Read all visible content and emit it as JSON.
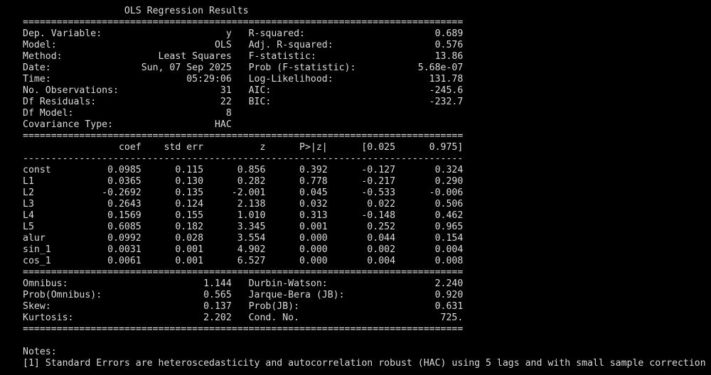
{
  "lines": [
    "                  OLS Regression Results                            ",
    "==============================================================================",
    "Dep. Variable:                      y   R-squared:                       0.689",
    "Model:                            OLS   Adj. R-squared:                  0.576",
    "Method:                 Least Squares   F-statistic:                     13.86",
    "Date:                Sun, 07 Sep 2025   Prob (F-statistic):           5.68e-07",
    "Time:                        05:29:06   Log-Likelihood:                 131.78",
    "No. Observations:                  31   AIC:                            -245.6",
    "Df Residuals:                      22   BIC:                            -232.7",
    "Df Model:                           8                                         ",
    "Covariance Type:                  HAC                                         ",
    "==============================================================================",
    "                 coef    std err          z      P>|z|      [0.025      0.975]",
    "------------------------------------------------------------------------------",
    "const          0.0985      0.115      0.856      0.392      -0.127       0.324",
    "L1             0.0365      0.130      0.282      0.778      -0.217       0.290",
    "L2            -0.2692      0.135     -2.001      0.045      -0.533      -0.006",
    "L3             0.2643      0.124      2.138      0.032       0.022       0.506",
    "L4             0.1569      0.155      1.010      0.313      -0.148       0.462",
    "L5             0.6085      0.182      3.345      0.001       0.252       0.965",
    "alur           0.0992      0.028      3.554      0.000       0.044       0.154",
    "sin_1          0.0031      0.001      4.902      0.000       0.002       0.004",
    "cos_1          0.0061      0.001      6.527      0.000       0.004       0.008",
    "==============================================================================",
    "Omnibus:                        1.144   Durbin-Watson:                   2.240",
    "Prob(Omnibus):                  0.565   Jarque-Bera (JB):                0.920",
    "Skew:                           0.137   Prob(JB):                        0.631",
    "Kurtosis:                       2.202   Cond. No.                         725.",
    "==============================================================================",
    "",
    "Notes:",
    "[1] Standard Errors are heteroscedasticity and autocorrelation robust (HAC) using 5 lags and with small sample correction"
  ]
}
